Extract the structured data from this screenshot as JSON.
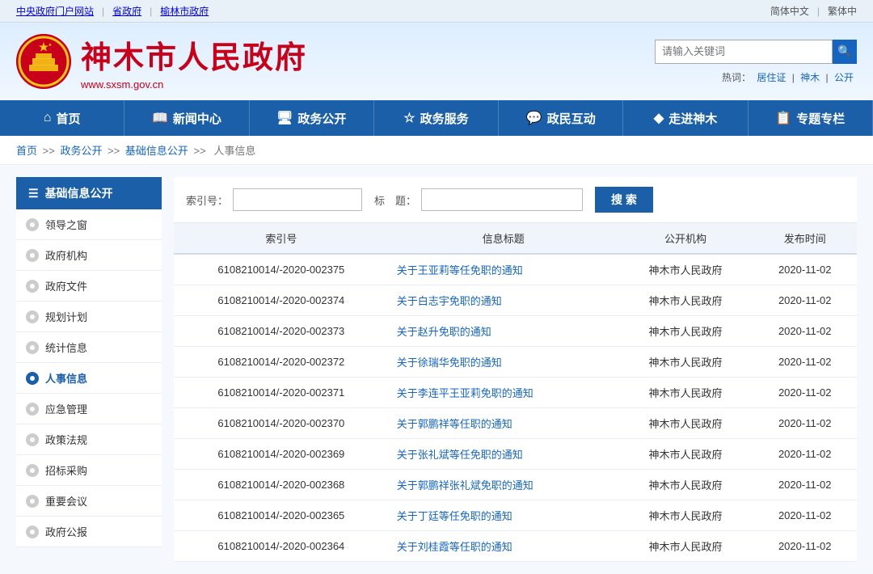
{
  "topbar": {
    "links": [
      "中央政府门户网站",
      "省政府",
      "榆林市政府"
    ],
    "lang": [
      "简体中文",
      "繁体中"
    ],
    "sep": "|"
  },
  "header": {
    "title": "神木市人民政府",
    "url": "www.sxsm.gov.cn",
    "search_placeholder": "请输入关键词",
    "hotwords_label": "热词：",
    "hotwords": [
      "居住证",
      "神木",
      "公开"
    ]
  },
  "nav": {
    "items": [
      {
        "icon": "⌂",
        "label": "首页"
      },
      {
        "icon": "📖",
        "label": "新闻中心"
      },
      {
        "icon": "🖥",
        "label": "政务公开"
      },
      {
        "icon": "☆",
        "label": "政务服务"
      },
      {
        "icon": "💬",
        "label": "政民互动"
      },
      {
        "icon": "◆",
        "label": "走进神木"
      },
      {
        "icon": "📋",
        "label": "专题专栏"
      }
    ]
  },
  "breadcrumb": {
    "items": [
      "首页",
      "政务公开",
      "基础信息公开",
      "人事信息"
    ]
  },
  "sidebar": {
    "title": "基础信息公开",
    "items": [
      {
        "label": "领导之窗",
        "active": false
      },
      {
        "label": "政府机构",
        "active": false
      },
      {
        "label": "政府文件",
        "active": false
      },
      {
        "label": "规划计划",
        "active": false
      },
      {
        "label": "统计信息",
        "active": false
      },
      {
        "label": "人事信息",
        "active": true
      },
      {
        "label": "应急管理",
        "active": false
      },
      {
        "label": "政策法规",
        "active": false
      },
      {
        "label": "招标采购",
        "active": false
      },
      {
        "label": "重要会议",
        "active": false
      },
      {
        "label": "政府公报",
        "active": false
      }
    ]
  },
  "content": {
    "search_index_label": "索引号：",
    "search_title_label": "标　题：",
    "search_button": "搜 索",
    "table": {
      "headers": [
        "索引号",
        "信息标题",
        "公开机构",
        "发布时间"
      ],
      "rows": [
        {
          "index": "6108210014/-2020-002375",
          "title": "关于王亚莉等任免职的通知",
          "org": "神木市人民政府",
          "date": "2020-11-02"
        },
        {
          "index": "6108210014/-2020-002374",
          "title": "关于白志宇免职的通知",
          "org": "神木市人民政府",
          "date": "2020-11-02"
        },
        {
          "index": "6108210014/-2020-002373",
          "title": "关于赵升免职的通知",
          "org": "神木市人民政府",
          "date": "2020-11-02"
        },
        {
          "index": "6108210014/-2020-002372",
          "title": "关于徐瑞华免职的通知",
          "org": "神木市人民政府",
          "date": "2020-11-02"
        },
        {
          "index": "6108210014/-2020-002371",
          "title": "关于李连平王亚莉免职的通知",
          "org": "神木市人民政府",
          "date": "2020-11-02"
        },
        {
          "index": "6108210014/-2020-002370",
          "title": "关于郭鹏祥等任职的通知",
          "org": "神木市人民政府",
          "date": "2020-11-02"
        },
        {
          "index": "6108210014/-2020-002369",
          "title": "关于张礼斌等任免职的通知",
          "org": "神木市人民政府",
          "date": "2020-11-02"
        },
        {
          "index": "6108210014/-2020-002368",
          "title": "关于郭鹏祥张礼斌免职的通知",
          "org": "神木市人民政府",
          "date": "2020-11-02"
        },
        {
          "index": "6108210014/-2020-002365",
          "title": "关于丁廷等任免职的通知",
          "org": "神木市人民政府",
          "date": "2020-11-02"
        },
        {
          "index": "6108210014/-2020-002364",
          "title": "关于刘桂霞等任职的通知",
          "org": "神木市人民政府",
          "date": "2020-11-02"
        }
      ]
    }
  }
}
